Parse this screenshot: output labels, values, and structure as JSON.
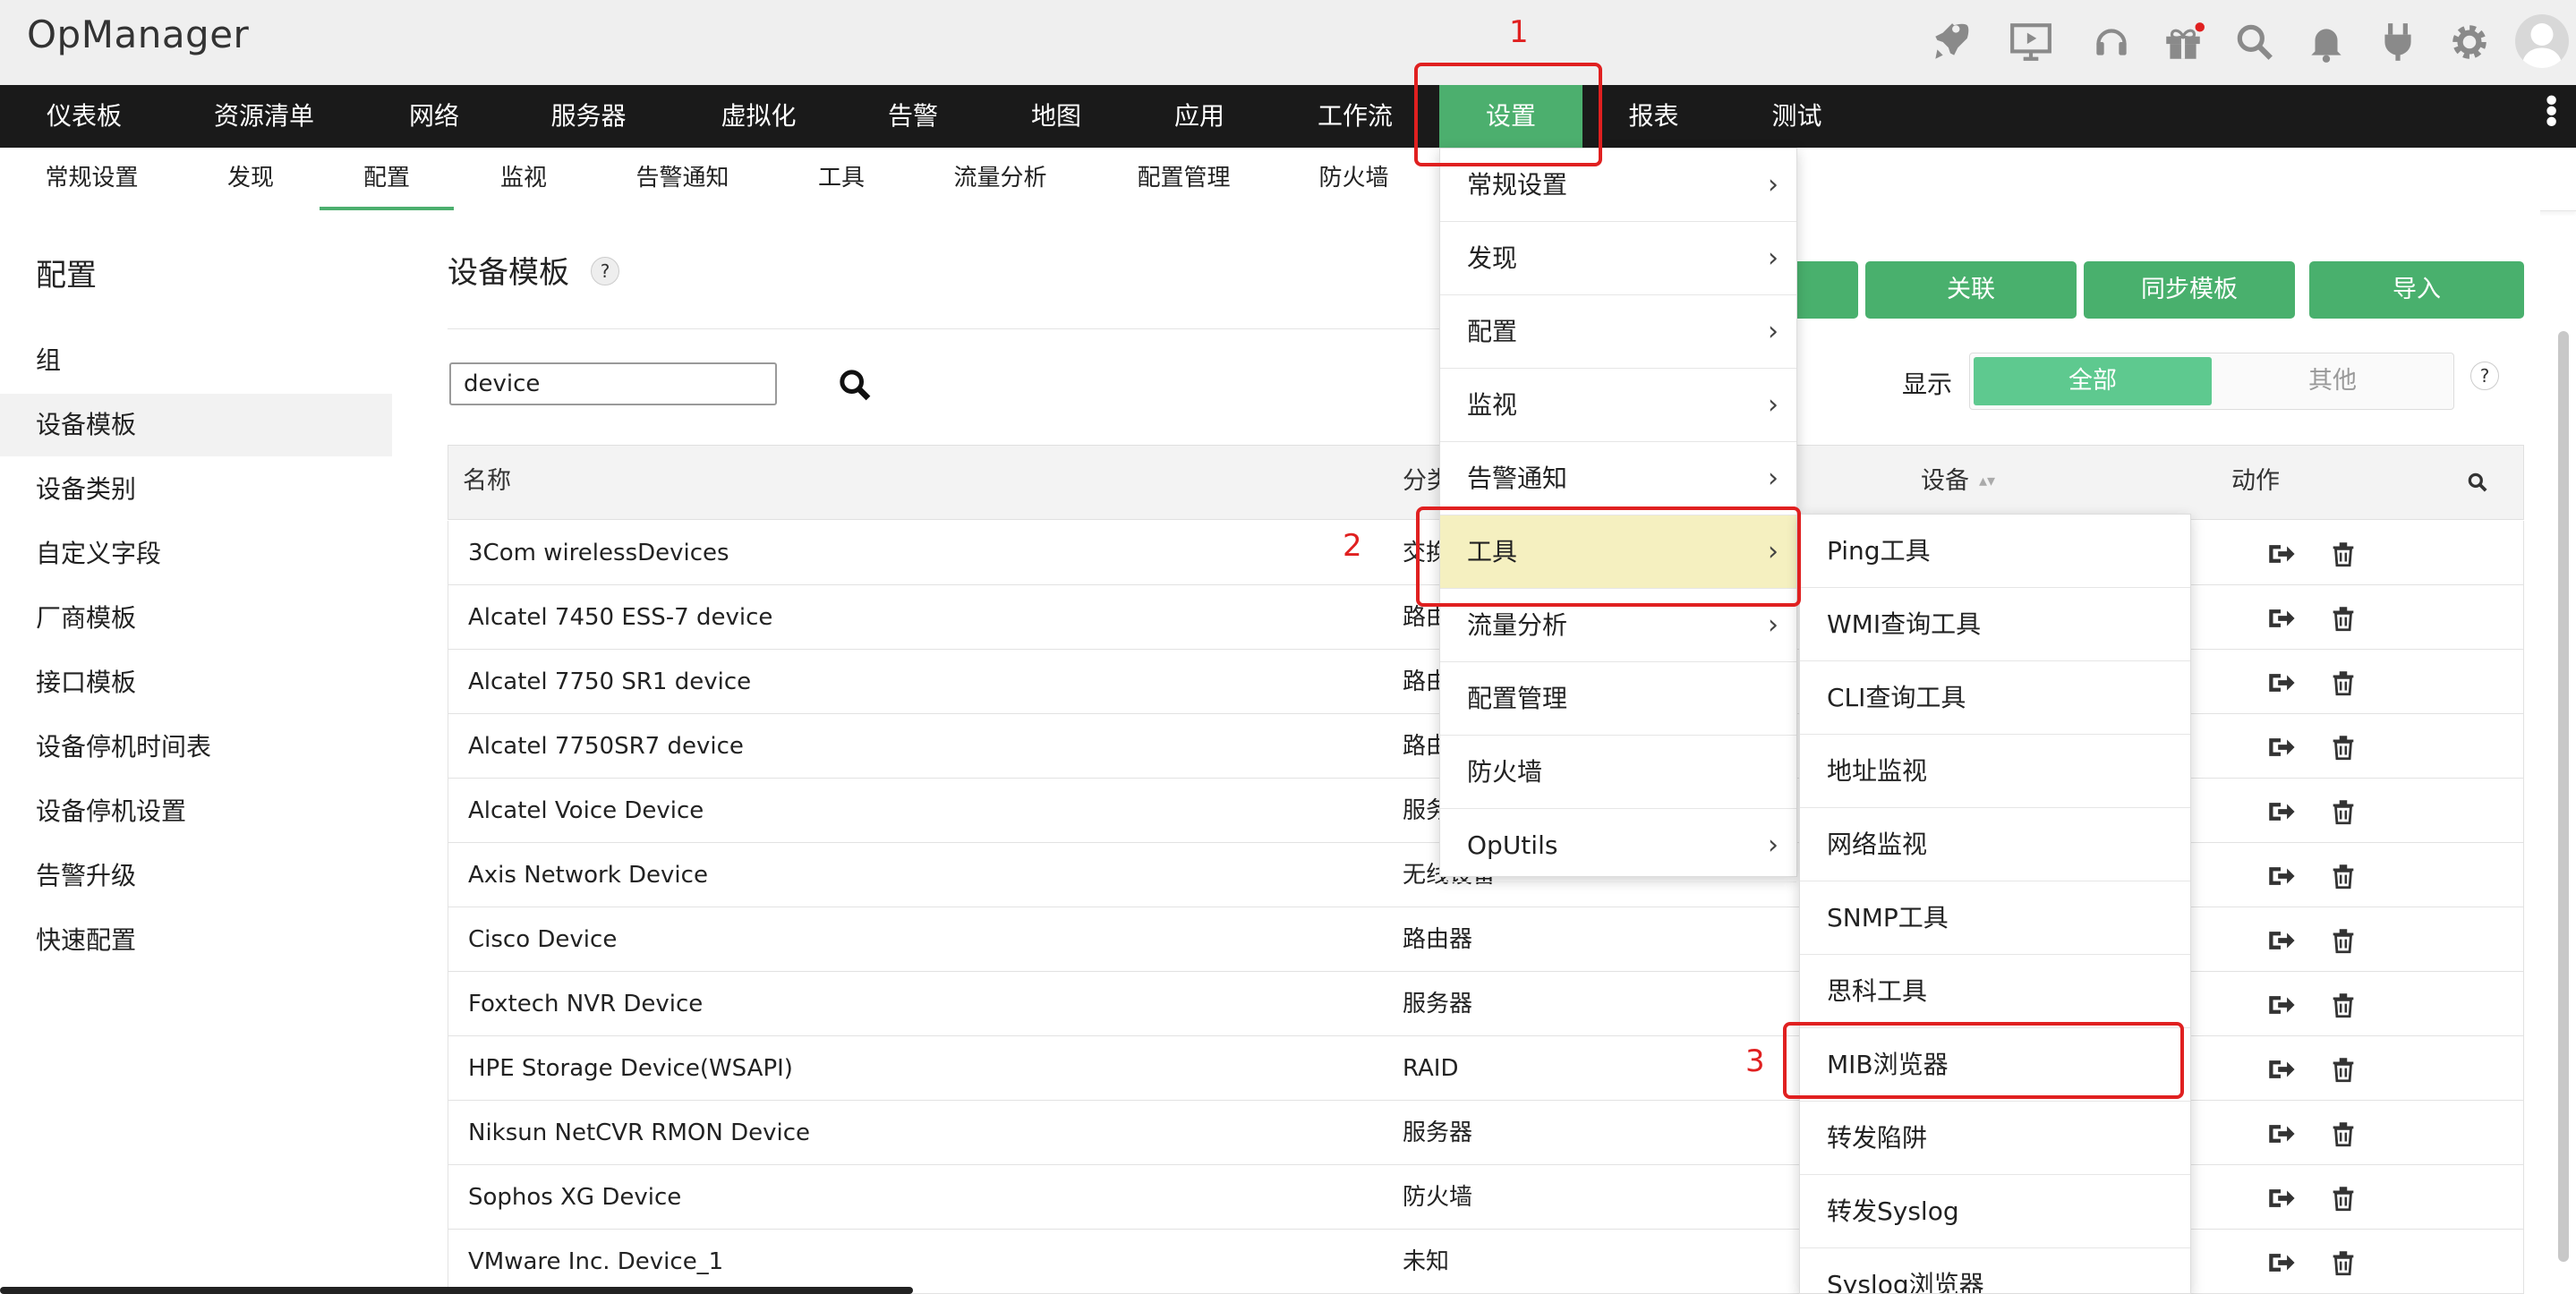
{
  "app": {
    "title": "OpManager"
  },
  "header_icons": [
    "rocket-icon",
    "presentation-icon",
    "headset-icon",
    "gift-icon",
    "search-icon",
    "bell-icon",
    "plug-icon",
    "gear-icon",
    "user-avatar"
  ],
  "main_nav": [
    "仪表板",
    "资源清单",
    "网络",
    "服务器",
    "虚拟化",
    "告警",
    "地图",
    "应用",
    "工作流",
    "设置",
    "报表",
    "测试"
  ],
  "active_main_nav": "设置",
  "sub_nav": [
    "常规设置",
    "发现",
    "配置",
    "监视",
    "告警通知",
    "工具",
    "流量分析",
    "配置管理",
    "防火墙"
  ],
  "active_sub_nav": "配置",
  "sidebar": {
    "title": "配置",
    "items": [
      "组",
      "设备模板",
      "设备类别",
      "自定义字段",
      "厂商模板",
      "接口模板",
      "设备停机时间表",
      "设备停机设置",
      "告警升级",
      "快速配置"
    ],
    "active": "设备模板"
  },
  "page": {
    "title": "设备模板",
    "help": "?",
    "search_value": "device",
    "buttons": [
      "关联",
      "同步模板",
      "导入"
    ],
    "show_label": "显示",
    "toggle": [
      "全部",
      "其他"
    ]
  },
  "table": {
    "headers": {
      "name": "名称",
      "category": "分类",
      "devices": "设备",
      "actions": "动作"
    },
    "rows": [
      {
        "name": "3Com wirelessDevices",
        "category": "交换机"
      },
      {
        "name": "Alcatel 7450 ESS-7 device",
        "category": "路由器"
      },
      {
        "name": "Alcatel 7750 SR1 device",
        "category": "路由器"
      },
      {
        "name": "Alcatel 7750SR7 device",
        "category": "路由器"
      },
      {
        "name": "Alcatel Voice Device",
        "category": "服务器"
      },
      {
        "name": "Axis Network Device",
        "category": "无线设备"
      },
      {
        "name": "Cisco Device",
        "category": "路由器"
      },
      {
        "name": "Foxtech NVR Device",
        "category": "服务器"
      },
      {
        "name": "HPE Storage Device(WSAPI)",
        "category": "RAID"
      },
      {
        "name": "Niksun NetCVR RMON Device",
        "category": "服务器"
      },
      {
        "name": "Sophos XG Device",
        "category": "防火墙"
      },
      {
        "name": "VMware Inc. Device_1",
        "category": "未知"
      }
    ]
  },
  "settings_menu": [
    {
      "label": "常规设置",
      "submenu": true
    },
    {
      "label": "发现",
      "submenu": true
    },
    {
      "label": "配置",
      "submenu": true
    },
    {
      "label": "监视",
      "submenu": true
    },
    {
      "label": "告警通知",
      "submenu": true
    },
    {
      "label": "工具",
      "submenu": true,
      "highlighted": true
    },
    {
      "label": "流量分析",
      "submenu": true
    },
    {
      "label": "配置管理",
      "submenu": false
    },
    {
      "label": "防火墙",
      "submenu": false
    },
    {
      "label": "OpUtils",
      "submenu": true
    }
  ],
  "tools_menu": [
    "Ping工具",
    "WMI查询工具",
    "CLI查询工具",
    "地址监视",
    "网络监视",
    "SNMP工具",
    "思科工具",
    "MIB浏览器",
    "转发陷阱",
    "转发Syslog",
    "Syslog浏览器"
  ],
  "annotations": [
    "1",
    "2",
    "3"
  ],
  "colors": {
    "accent": "#4caf6e",
    "highlight": "#f5f0c0",
    "annotation": "#e02020",
    "nav_bg": "#1a1a1a"
  }
}
